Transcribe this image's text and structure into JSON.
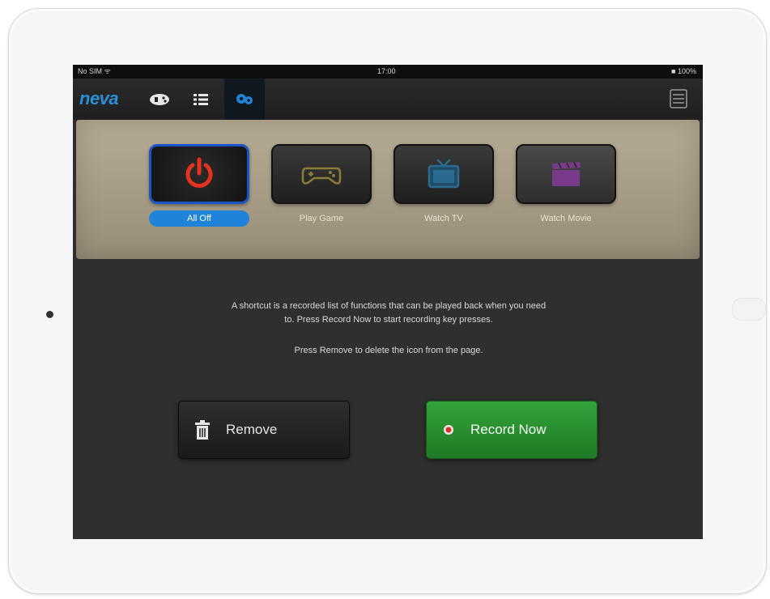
{
  "status_bar": {
    "carrier": "No SIM ᯤ",
    "time": "17:00",
    "battery": "■ 100%"
  },
  "toolbar": {
    "logo": "neva",
    "tabs": [
      {
        "icon": "remote-icon"
      },
      {
        "icon": "list-icon"
      },
      {
        "icon": "shortcuts-icon",
        "active": true
      }
    ],
    "right_icon": "grid-icon"
  },
  "shortcuts": [
    {
      "label": "All Off",
      "icon": "power-icon",
      "color": "#e3321f",
      "selected": true
    },
    {
      "label": "Play Game",
      "icon": "gamepad-icon",
      "color": "#8a7d3a",
      "selected": false
    },
    {
      "label": "Watch TV",
      "icon": "tv-icon",
      "color": "#2a6a8e",
      "selected": false
    },
    {
      "label": "Watch Movie",
      "icon": "movie-icon",
      "color": "#7a3a8a",
      "selected": false
    }
  ],
  "info": {
    "line1": "A shortcut is a recorded list of functions that can be played back when you need",
    "line2": "to. Press Record Now to start recording key presses.",
    "line3": "Press Remove to delete the icon from the page."
  },
  "buttons": {
    "remove_label": "Remove",
    "record_label": "Record Now"
  },
  "colors": {
    "accent": "#1f83d9",
    "record_green": "#2a8f31",
    "power_red": "#e3321f"
  }
}
